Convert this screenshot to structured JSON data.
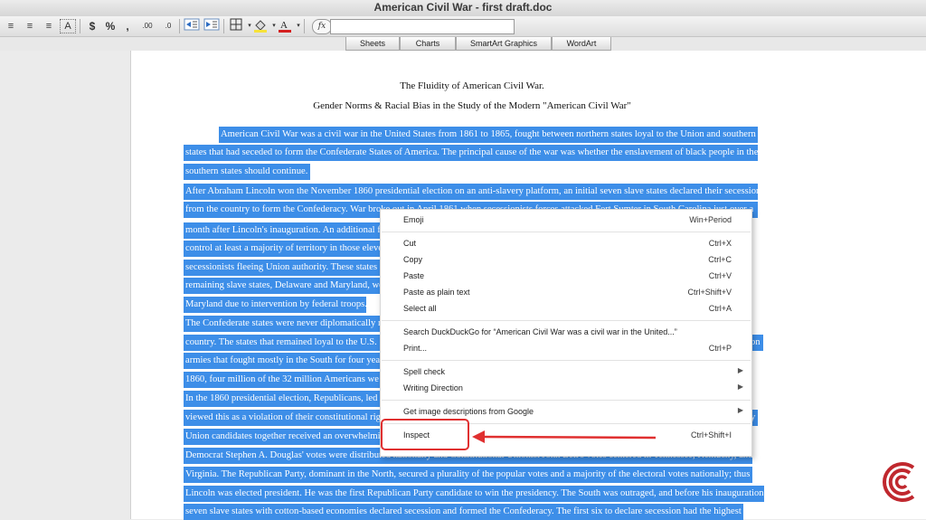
{
  "window": {
    "title": "American Civil War - first draft.doc"
  },
  "toolbar": {
    "align_left": "≡",
    "align_center": "≡",
    "align_right": "≡",
    "shrink": "A",
    "currency": "$",
    "percent": "%",
    "comma": ",",
    "inc_decimal": ".00",
    "dec_decimal": ".0",
    "fx": "fx",
    "formula_value": ""
  },
  "ribbon": {
    "tabs": [
      "Sheets",
      "Charts",
      "SmartArt Graphics",
      "WordArt"
    ]
  },
  "document": {
    "title": "The Fluidity of American Civil War.",
    "subtitle": "Gender Norms & Racial Bias in the Study of the Modern \"American Civil War\"",
    "lines": [
      "American Civil War  was a civil war in the United States from 1861 to 1865, fought between northern states loyal to the Union and southern",
      "states that had seceded to form the Confederate States of America. The principal cause of the war was whether the enslavement of black people in the",
      "southern states should continue.",
      "After Abraham Lincoln won the November 1860 presidential election on an anti-slavery platform, an initial seven slave states declared their secession",
      "from the country to form the Confederacy. War broke out in April 1861 when secessionists forces attacked Fort Sumter in South Carolina just over a",
      "month after Lincoln's inauguration. An additional f",
      "control at least a majority of territory in those eleve",
      "secessionists fleeing Union authority. These states",
      "remaining slave states, Delaware and Maryland, we",
      "Maryland due to intervention by federal troops.",
      "The Confederate states were never diplomatically r",
      "country. The states that remained loyal to the U.S.",
      "armies that fought mostly in the South for four yea",
      "1860, four million of the 32 million Americans we",
      "In the 1860 presidential election, Republicans, led",
      "viewed this as a violation of their constitutional rig",
      "Union candidates together received an overwhelmi",
      "Democrat Stephen A. Douglas' votes were distributed nationally and Constitutional Unionist John Bell's votes centered in Tennessee, Kentucky, and",
      "Virginia. The Republican Party, dominant in the North, secured a plurality of the popular votes and a majority of the electoral votes nationally; thus",
      "Lincoln was elected president. He was the first Republican Party candidate to win the presidency. The South was outraged, and before his inauguration,",
      "seven slave states with cotton-based economies declared secession and formed the Confederacy. The first six to declare secession had the highest"
    ],
    "right_fragments": [
      "on",
      "y"
    ]
  },
  "context_menu": {
    "items": [
      {
        "label": "Emoji",
        "shortcut": "Win+Period"
      },
      {
        "label": "Cut",
        "shortcut": "Ctrl+X"
      },
      {
        "label": "Copy",
        "shortcut": "Ctrl+C"
      },
      {
        "label": "Paste",
        "shortcut": "Ctrl+V"
      },
      {
        "label": "Paste as plain text",
        "shortcut": "Ctrl+Shift+V"
      },
      {
        "label": "Select all",
        "shortcut": "Ctrl+A"
      },
      {
        "label": "Search DuckDuckGo for “American Civil War  was a civil war in the United...”",
        "shortcut": ""
      },
      {
        "label": "Print...",
        "shortcut": "Ctrl+P"
      },
      {
        "label": "Spell check",
        "shortcut": ""
      },
      {
        "label": "Writing Direction",
        "shortcut": ""
      },
      {
        "label": "Get image descriptions from Google",
        "shortcut": ""
      },
      {
        "label": "Inspect",
        "shortcut": "Ctrl+Shift+I"
      }
    ]
  },
  "colors": {
    "selection": "#3d8ee8",
    "highlight_box": "#e03030",
    "logo": "#c0282e"
  },
  "icons": [
    "align-left-icon",
    "align-center-icon",
    "align-right-icon",
    "shrink-text-icon",
    "currency-icon",
    "percent-icon",
    "comma-icon",
    "increase-decimal-icon",
    "decrease-decimal-icon",
    "indent-decrease-icon",
    "indent-increase-icon",
    "borders-icon",
    "fill-color-icon",
    "font-color-icon",
    "submenu-arrow-icon",
    "red-arrow-icon",
    "brand-logo-icon"
  ]
}
